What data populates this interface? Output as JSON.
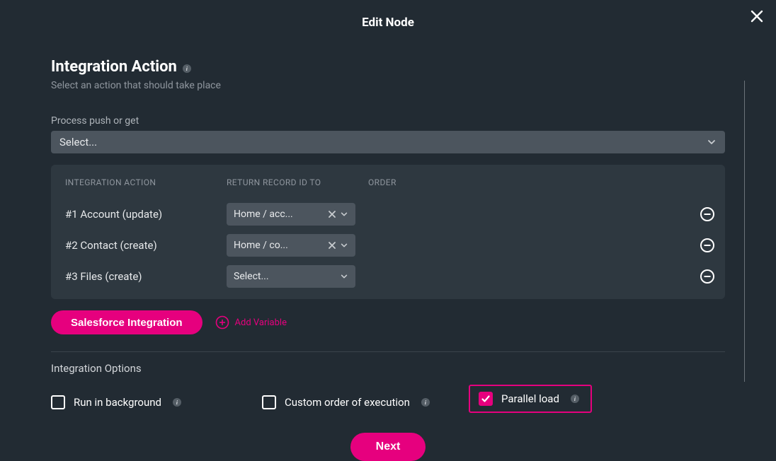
{
  "modal": {
    "title": "Edit Node"
  },
  "header": {
    "title": "Integration Action",
    "subtitle": "Select an action that should take place"
  },
  "processField": {
    "label": "Process push or get",
    "placeholder": "Select..."
  },
  "table": {
    "headers": {
      "c1": "INTEGRATION ACTION",
      "c2": "RETURN RECORD ID TO",
      "c3": "ORDER"
    },
    "rows": [
      {
        "label": "#1 Account (update)",
        "value": "Home / acc...",
        "hasValue": true
      },
      {
        "label": "#2 Contact (create)",
        "value": "Home / co...",
        "hasValue": true
      },
      {
        "label": "#3 Files (create)",
        "value": "Select...",
        "hasValue": false
      }
    ]
  },
  "buttons": {
    "salesforce": "Salesforce Integration",
    "addVar": "Add Variable",
    "next": "Next"
  },
  "optionsSection": {
    "title": "Integration Options",
    "items": [
      {
        "label": "Run in background",
        "checked": false
      },
      {
        "label": "Custom order of execution",
        "checked": false
      },
      {
        "label": "Parallel load",
        "checked": true
      }
    ]
  }
}
